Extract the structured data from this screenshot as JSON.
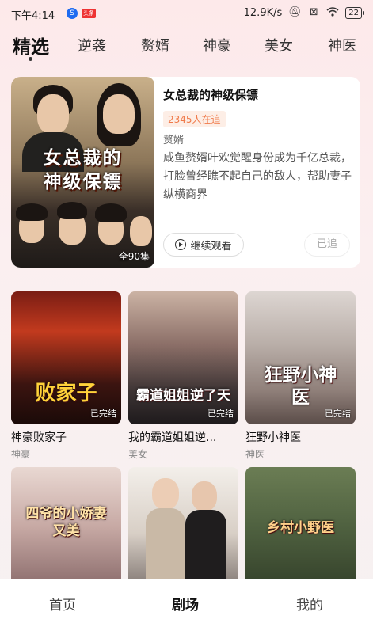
{
  "status_bar": {
    "time": "下午4:14",
    "app_badge": "头条",
    "speed": "12.9K/s",
    "battery": "22"
  },
  "tabs": [
    "精选",
    "逆袭",
    "赘婿",
    "神豪",
    "美女",
    "神医"
  ],
  "featured": {
    "poster_title_line1": "女总裁的",
    "poster_title_line2": "神级保镖",
    "episodes": "全90集",
    "title": "女总裁的神级保镖",
    "viewers": "2345人在追",
    "genre": "赘婿",
    "description": "咸鱼赘婿叶欢觉醒身份成为千亿总裁，打脸曾经瞧不起自己的敌人，帮助妻子纵横商界",
    "watch_label": "继续观看",
    "follow_label": "已追"
  },
  "grid": [
    {
      "title": "神豪败家子",
      "genre": "神豪",
      "poster_text": "败家子",
      "status": "已完结"
    },
    {
      "title": "我的霸道姐姐逆...",
      "genre": "美女",
      "poster_text": "霸道姐姐逆了天",
      "status": "已完结"
    },
    {
      "title": "狂野小神医",
      "genre": "神医",
      "poster_text": "狂野小神医",
      "status": "已完结"
    },
    {
      "title": "",
      "genre": "",
      "poster_text": "四爷的小娇妻又美",
      "status": ""
    },
    {
      "title": "",
      "genre": "",
      "poster_text": "",
      "status": ""
    },
    {
      "title": "",
      "genre": "",
      "poster_text": "乡村小野医",
      "status": ""
    }
  ],
  "bottom_nav": [
    "首页",
    "剧场",
    "我的"
  ]
}
